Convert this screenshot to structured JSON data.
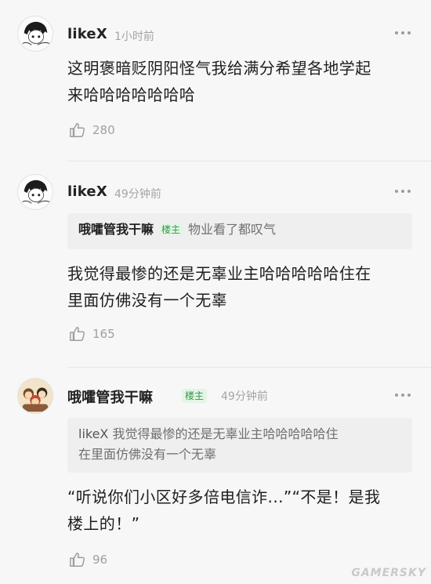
{
  "comments": [
    {
      "author": "likeX",
      "time": "1小时前",
      "text_line1": "这明褒暗贬阴阳怪气我给满分希望各地学起",
      "text_line2": "来哈哈哈哈哈哈哈",
      "likes": "280",
      "avatar_icon": "anime-character-avatar"
    },
    {
      "author": "likeX",
      "time": "49分钟前",
      "quote_author": "哦嚯管我干嘛",
      "quote_tag": "楼主",
      "quote_text": "物业看了都叹气",
      "text_line1": "我觉得最惨的还是无辜业主哈哈哈哈哈住在",
      "text_line2": "里面仿佛没有一个无辜",
      "likes": "165",
      "avatar_icon": "anime-character-avatar"
    },
    {
      "author": "哦嚯管我干嘛",
      "tag": "楼主",
      "time": "49分钟前",
      "quote_author": "likeX",
      "quote_text_line1": "我觉得最惨的还是无辜业主哈哈哈哈哈住",
      "quote_text_line2": "在里面仿佛没有一个无辜",
      "text_line1": "“听说你们小区好多倍电信诈...”“不是！是我",
      "text_line2": "楼上的！”",
      "likes": "96",
      "avatar_icon": "cartoon-group-avatar"
    }
  ],
  "watermark": "GAMERSKY",
  "colors": {
    "background": "#f7f7f7",
    "tag_green": "#2f9a45",
    "tag_bg": "#e5f4e7",
    "muted": "#a4a4a4"
  }
}
